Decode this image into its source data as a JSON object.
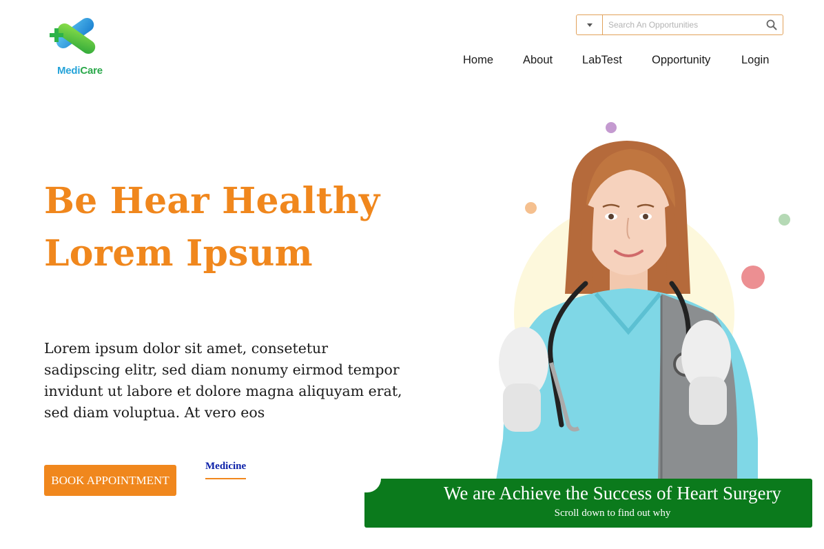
{
  "brand": {
    "name_part1": "Medi",
    "name_part2": "Care",
    "colors": {
      "blue": "#25a3d9",
      "green": "#2aa84a"
    }
  },
  "search": {
    "placeholder": "Search An Opportunities",
    "dropdown_icon": "caret-down-icon",
    "button_icon": "search-icon"
  },
  "nav": {
    "items": [
      "Home",
      "About",
      "LabTest",
      "Opportunity",
      "Login"
    ]
  },
  "hero": {
    "title_line1": "Be Hear Healthy",
    "title_line2": "Lorem Ipsum",
    "description": "Lorem ipsum dolor sit amet, consetetur sadipscing elitr, sed diam nonumy eirmod tempor invidunt ut labore et dolore magna aliquyam erat, sed diam voluptua. At vero eos",
    "book_button": "BOOK APPOINTMENT",
    "medicine_link": "Medicine"
  },
  "banner": {
    "headline": "We are Achieve the Success of Heart Surgery",
    "subtext": "Scroll down to find out why"
  },
  "colors": {
    "accent": "#f0871d",
    "banner": "#0b7a1c",
    "link": "#0a1fa8"
  }
}
